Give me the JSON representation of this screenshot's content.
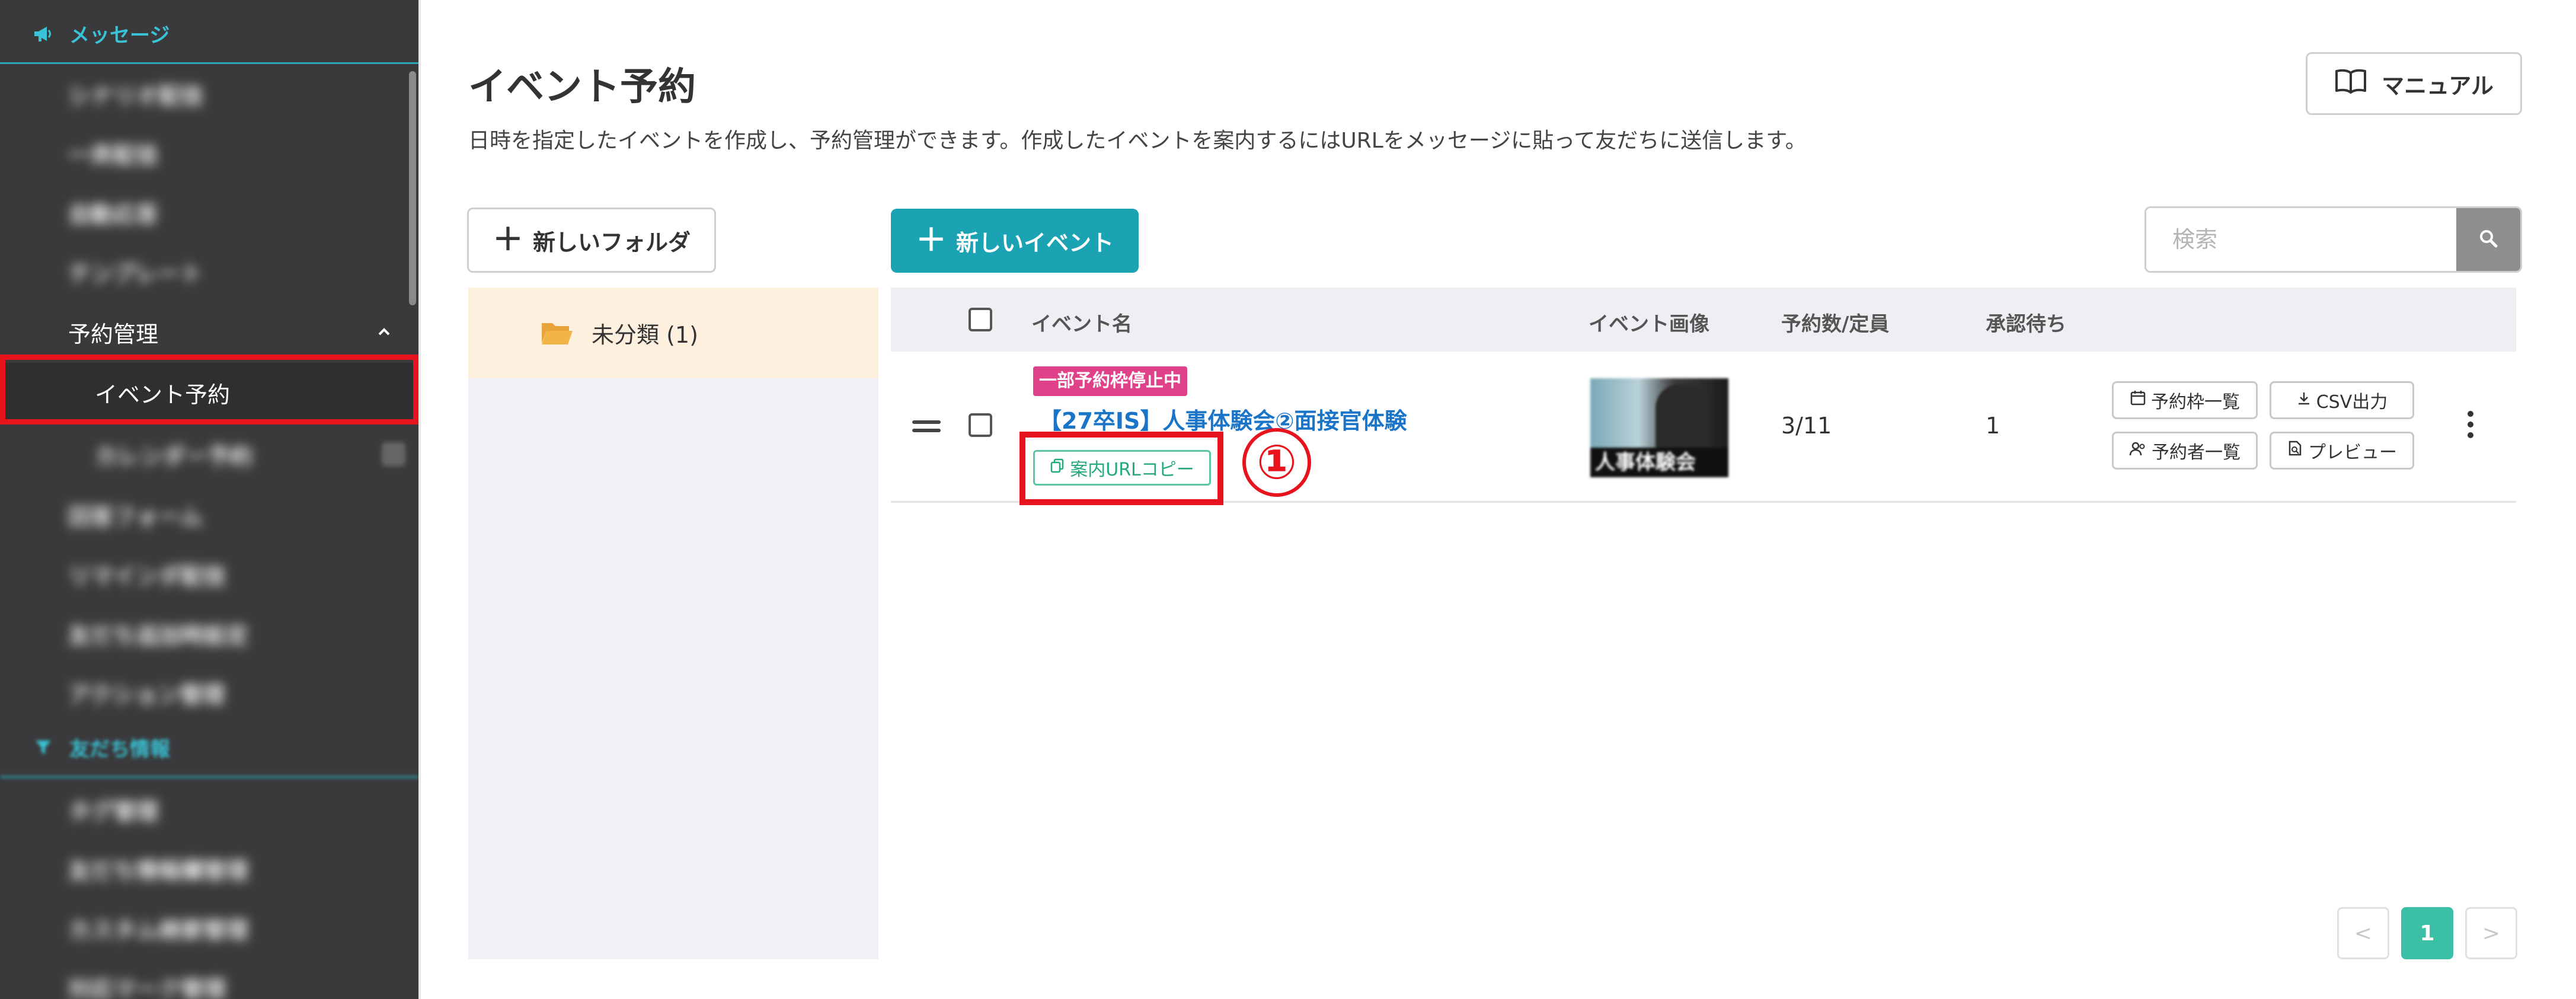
{
  "sidebar": {
    "section_message": "メッセージ",
    "items_top": [
      "シナリオ配信",
      "一斉配信",
      "自動応答",
      "テンプレート"
    ],
    "reservation_group": "予約管理",
    "event_reservation": "イベント予約",
    "calendar_reservation": "カレンダー予約",
    "items_bottom": [
      "回答フォーム",
      "リマインダ配信",
      "友だち追加時設定",
      "アクション管理"
    ],
    "section_friends": "友だち情報",
    "items_friends": [
      "タグ管理",
      "友だち情報欄管理",
      "カスタム検索管理",
      "対応マーク管理"
    ]
  },
  "header": {
    "title": "イベント予約",
    "description": "日時を指定したイベントを作成し、予約管理ができます。作成したイベントを案内するにはURLをメッセージに貼って友だちに送信します。",
    "manual_label": "マニュアル"
  },
  "toolbar": {
    "new_folder_label": "新しいフォルダ",
    "new_event_label": "新しいイベント",
    "search_placeholder": "検索"
  },
  "folders": {
    "uncategorized": "未分類 (1)"
  },
  "table": {
    "headers": {
      "name": "イベント名",
      "image": "イベント画像",
      "reservations": "予約数/定員",
      "pending": "承認待ち"
    },
    "row": {
      "badge": "一部予約枠停止中",
      "name": "【27卒IS】人事体験会②面接官体験",
      "copy_url": "案内URLコピー",
      "image_caption": "人事体験会",
      "reservations": "3/11",
      "pending": "1",
      "btn_slots": "予約枠一覧",
      "btn_csv": "CSV出力",
      "btn_reservers": "予約者一覧",
      "btn_preview": "プレビュー"
    }
  },
  "annotation": {
    "marker": "①",
    "color": "#e8141d"
  },
  "pagination": {
    "prev": "<",
    "current": "1",
    "next": ">"
  },
  "colors": {
    "sidebar_bg": "#3a3a3c",
    "accent_teal": "#1ba3b3",
    "badge_pink": "#e0428a",
    "link_blue": "#1a75c9",
    "highlight_red": "#e8141d"
  }
}
